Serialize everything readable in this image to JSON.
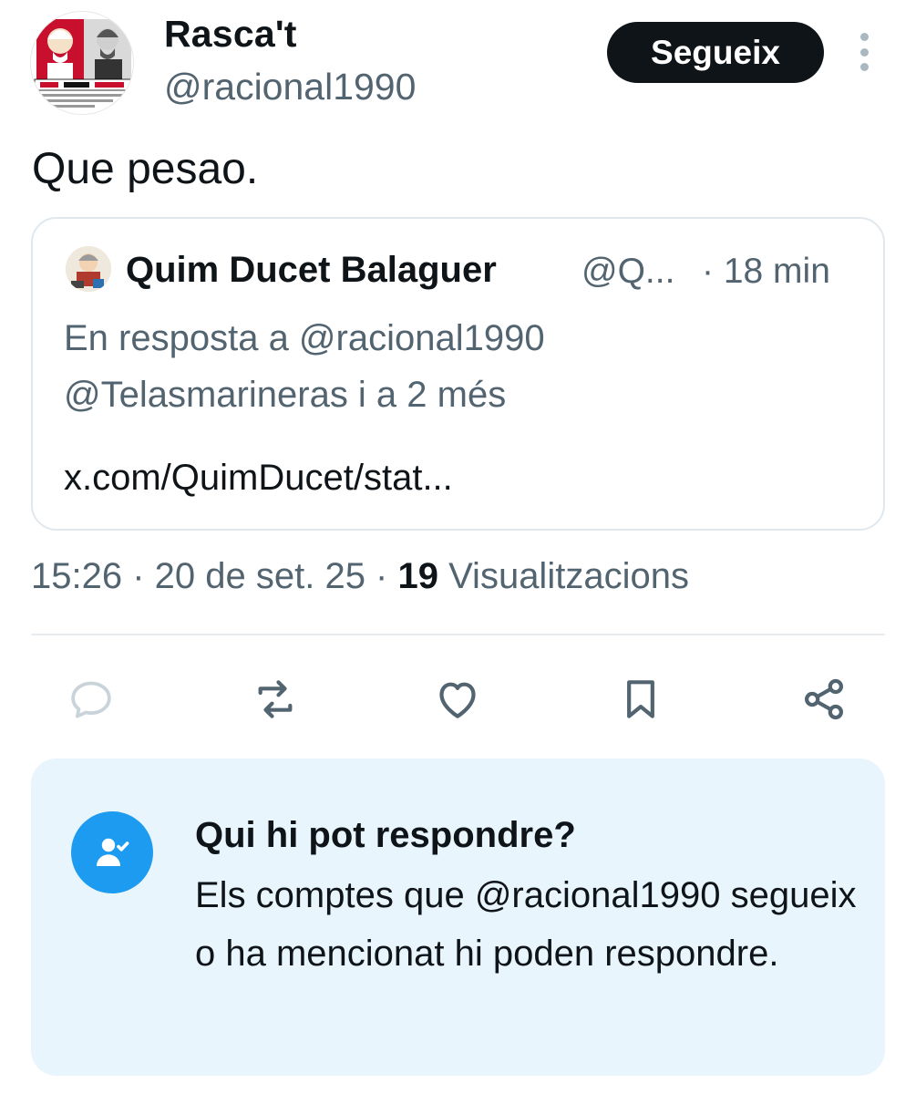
{
  "author": {
    "name": "Rasca't",
    "handle": "@racional1990",
    "avatar_icon": "kfc-parody-avatar"
  },
  "follow_button_label": "Segueix",
  "tweet_text": "Que pesao.",
  "quoted_tweet": {
    "name": "Quim Ducet Balaguer",
    "handle": "@Q...",
    "time": "· 18 min",
    "reply_line_1": "En resposta a @racional1990",
    "reply_line_2": "@Telasmarineras i a 2 més",
    "link": "x.com/QuimDucet/stat..."
  },
  "meta": {
    "time_date": "15:26 · 20 de set. 25 · ",
    "views_count": "19",
    "views_label": " Visualitzacions"
  },
  "actions": [
    "reply-icon",
    "retweet-icon",
    "like-icon",
    "bookmark-icon",
    "share-icon"
  ],
  "reply_restriction": {
    "title": "Qui hi pot respondre?",
    "body": "Els comptes que @racional1990 segueix o ha mencionat hi poden respondre."
  },
  "colors": {
    "text_primary": "#0f1419",
    "text_secondary": "#536471",
    "accent_blue": "#1d9bf0",
    "panel_bg": "#e8f5fd"
  }
}
